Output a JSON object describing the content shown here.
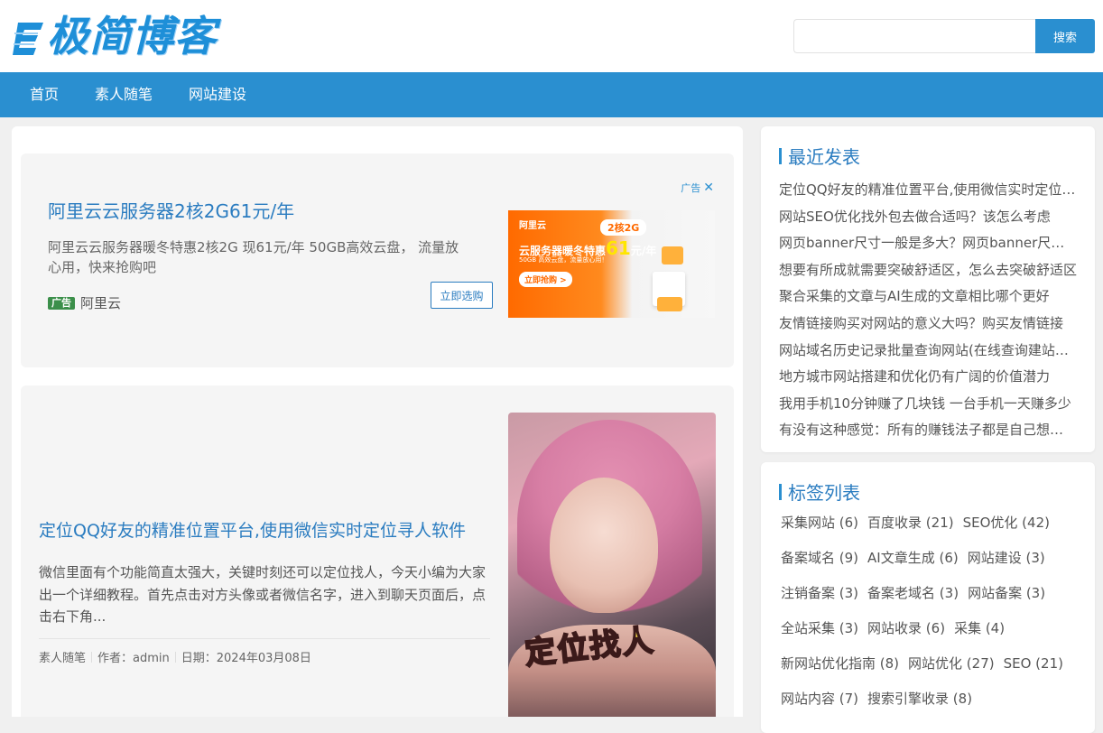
{
  "site": {
    "logo_text": "极简博客"
  },
  "search": {
    "placeholder": "",
    "button": "搜索"
  },
  "nav": {
    "items": [
      "首页",
      "素人随笔",
      "网站建设"
    ]
  },
  "ad": {
    "close_label": "广告",
    "title": "阿里云云服务器2核2G61元/年",
    "desc": "阿里云云服务器暖冬特惠2核2G 现61元/年 50GB高效云盘， 流量放心用，快来抢购吧",
    "badge": "广告",
    "source": "阿里云",
    "cta": "立即选购",
    "image": {
      "brand": "阿里云",
      "tag": "2核2G",
      "headline": "云服务器暖冬特惠",
      "price": "61",
      "unit": "元/年",
      "sub": "50GB 高效云盘，流量放心用！",
      "cta": "立即抢购 >"
    }
  },
  "post": {
    "title": "定位QQ好友的精准位置平台,使用微信实时定位寻人软件",
    "excerpt": "微信里面有个功能简直太强大，关键时刻还可以定位找人，今天小编为大家出一个详细教程。首先点击对方头像或者微信名字，进入到聊天页面后，点击右下角...",
    "category": "素人随笔",
    "author": "作者：admin",
    "date": "日期：2024年03月08日",
    "image_text": "定位找人"
  },
  "recent": {
    "title": "最近发表",
    "items": [
      "定位QQ好友的精准位置平台,使用微信实时定位寻人软件",
      "网站SEO优化找外包去做合适吗？该怎么考虑",
      "网页banner尺寸一般是多大？网页banner尺寸规范",
      "想要有所成就需要突破舒适区，怎么去突破舒适区",
      "聚合采集的文章与AI生成的文章相比哪个更好",
      "友情链接购买对网站的意义大吗？购买友情链接",
      "网站域名历史记录批量查询网站(在线查询建站历史)",
      "地方城市网站搭建和优化仍有广阔的价值潜力",
      "我用手机10分钟赚了几块钱 一台手机一天赚多少",
      "有没有这种感觉：所有的赚钱法子都是自己想出来的"
    ]
  },
  "tags": {
    "title": "标签列表",
    "items": [
      "采集网站 (6)",
      "百度收录 (21)",
      "SEO优化 (42)",
      "备案域名 (9)",
      "AI文章生成 (6)",
      "网站建设 (3)",
      "注销备案 (3)",
      "备案老域名 (3)",
      "网站备案 (3)",
      "全站采集 (3)",
      "网站收录 (6)",
      "采集 (4)",
      "新网站优化指南 (8)",
      "网站优化 (27)",
      "SEO (21)",
      "网站内容 (7)",
      "搜索引擎收录 (8)"
    ]
  },
  "colors": {
    "accent": "#2a8fd0",
    "link": "#2a7cc0",
    "ad_badge": "#3b8f4a",
    "ad_orange": "#ff6a00"
  }
}
